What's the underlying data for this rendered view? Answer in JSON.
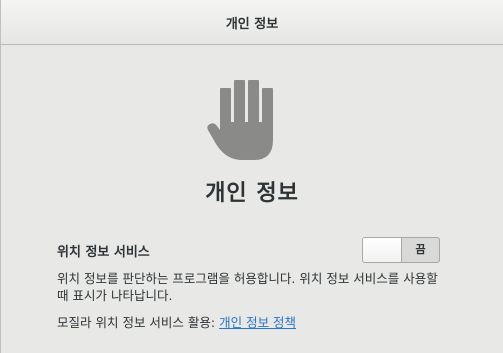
{
  "header": {
    "title": "개인 정보"
  },
  "main": {
    "icon": "hand-stop-icon",
    "icon_color": "#8a8a89",
    "title": "개인 정보",
    "location_service": {
      "label": "위치 정보 서비스",
      "toggle_state_label": "끔",
      "enabled": false,
      "description": "위치 정보를 판단하는 프로그램을 허용합니다. 위치 정보 서비스를 사용할 때 표시가 나타납니다.",
      "usage_prefix": "모질라 위치 정보 서비스 활용:",
      "policy_link": "개인 정보 정책",
      "link_color": "#2a76c6"
    }
  }
}
